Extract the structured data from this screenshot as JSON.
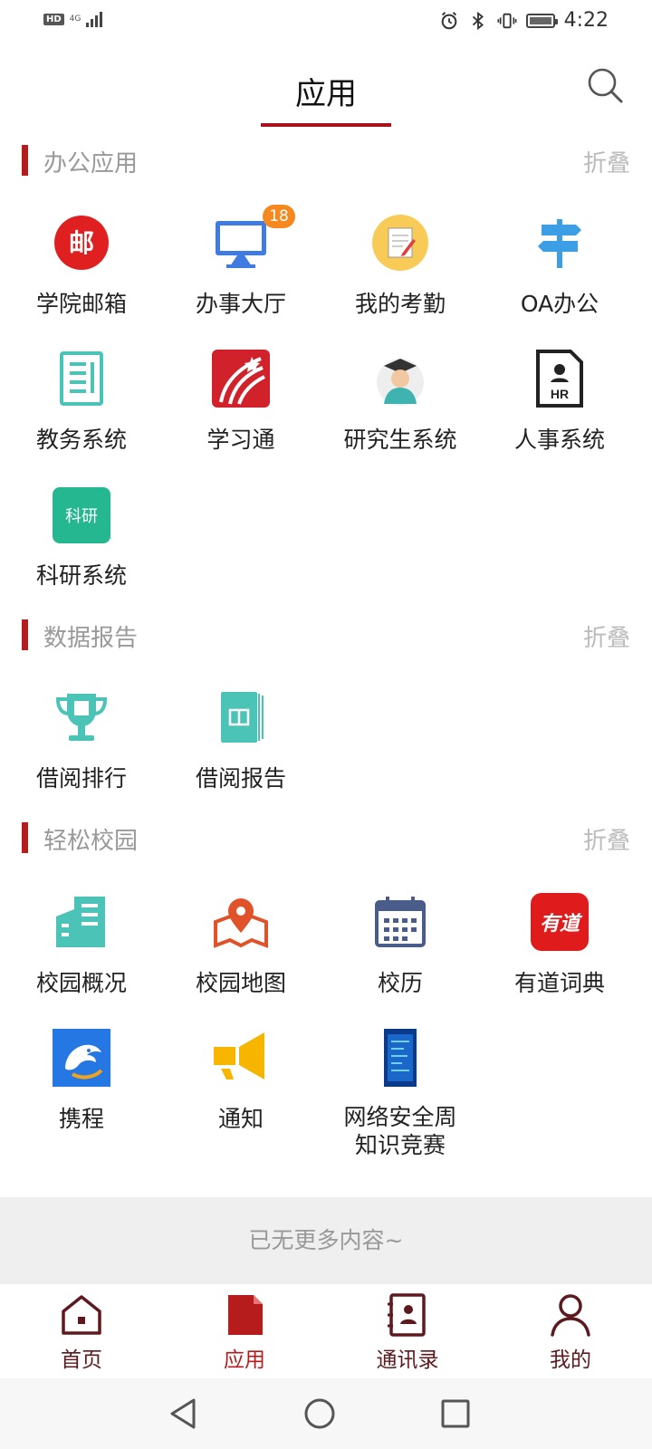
{
  "status_bar": {
    "hd": "HD",
    "network": "4G",
    "time": "4:22"
  },
  "header": {
    "title": "应用"
  },
  "sections": [
    {
      "title": "办公应用",
      "fold_label": "折叠",
      "apps": [
        {
          "label": "学院邮箱",
          "icon": "mail-icon"
        },
        {
          "label": "办事大厅",
          "icon": "monitor-icon",
          "badge": "18"
        },
        {
          "label": "我的考勤",
          "icon": "attendance-icon"
        },
        {
          "label": "OA办公",
          "icon": "signpost-icon"
        },
        {
          "label": "教务系统",
          "icon": "document-icon"
        },
        {
          "label": "学习通",
          "icon": "xuexitong-icon"
        },
        {
          "label": "研究生系统",
          "icon": "graduate-icon"
        },
        {
          "label": "人事系统",
          "icon": "hr-icon"
        },
        {
          "label": "科研系统",
          "icon": "research-icon",
          "icon_text": "科研"
        }
      ]
    },
    {
      "title": "数据报告",
      "fold_label": "折叠",
      "apps": [
        {
          "label": "借阅排行",
          "icon": "trophy-icon"
        },
        {
          "label": "借阅报告",
          "icon": "book-icon"
        }
      ]
    },
    {
      "title": "轻松校园",
      "fold_label": "折叠",
      "apps": [
        {
          "label": "校园概况",
          "icon": "building-icon"
        },
        {
          "label": "校园地图",
          "icon": "map-icon"
        },
        {
          "label": "校历",
          "icon": "calendar-icon"
        },
        {
          "label": "有道词典",
          "icon": "youdao-icon",
          "icon_text": "有道"
        },
        {
          "label": "携程",
          "icon": "ctrip-icon"
        },
        {
          "label": "通知",
          "icon": "megaphone-icon"
        },
        {
          "label": "网络安全周\n知识竞赛",
          "icon": "security-week-icon"
        }
      ]
    }
  ],
  "footer": {
    "no_more": "已无更多内容~"
  },
  "bottom_nav": [
    {
      "label": "首页",
      "icon": "home-icon",
      "active": false
    },
    {
      "label": "应用",
      "icon": "apps-icon",
      "active": true
    },
    {
      "label": "通讯录",
      "icon": "contacts-icon",
      "active": false
    },
    {
      "label": "我的",
      "icon": "profile-icon",
      "active": false
    }
  ],
  "colors": {
    "accent": "#b71c1c",
    "badge": "#f5891f",
    "teal": "#4cc3b7"
  }
}
